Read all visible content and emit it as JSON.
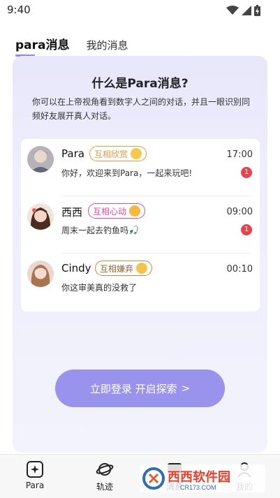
{
  "status": {
    "time": "9:40"
  },
  "tabs": {
    "active": "para消息",
    "other": "我的消息"
  },
  "card": {
    "title": "什么是Para消息?",
    "desc": "你可以在上帝视角看到数字人之间的对话，并且一眼识别同频好友展开真人对话。"
  },
  "messages": [
    {
      "name": "Para",
      "tag": "互相欣赏",
      "time": "17:00",
      "text": "你好，欢迎来到Para，一起来玩吧!",
      "badge": "1",
      "tag_color": "#e79a43"
    },
    {
      "name": "西西",
      "tag": "互相心动",
      "time": "09:00",
      "text": "周末一起去钓鱼吗🎣",
      "badge": "1",
      "tag_color": "#e84aa0"
    },
    {
      "name": "Cindy",
      "tag": "互相嫌弃",
      "time": "00:10",
      "text": "你这审美真的没救了",
      "badge": "",
      "tag_color": "#c98a3a"
    }
  ],
  "login_button": {
    "label": "立即登录 开启探索",
    "arrow": ">"
  },
  "nav": [
    {
      "label": "Para",
      "icon": "sparkle-square-icon"
    },
    {
      "label": "轨迹",
      "icon": "planet-icon"
    },
    {
      "label": "消息",
      "icon": "message-icon"
    },
    {
      "label": "我的",
      "icon": "user-icon"
    }
  ],
  "watermark": {
    "text": "西西软件园",
    "sub": "CR173.COM"
  }
}
